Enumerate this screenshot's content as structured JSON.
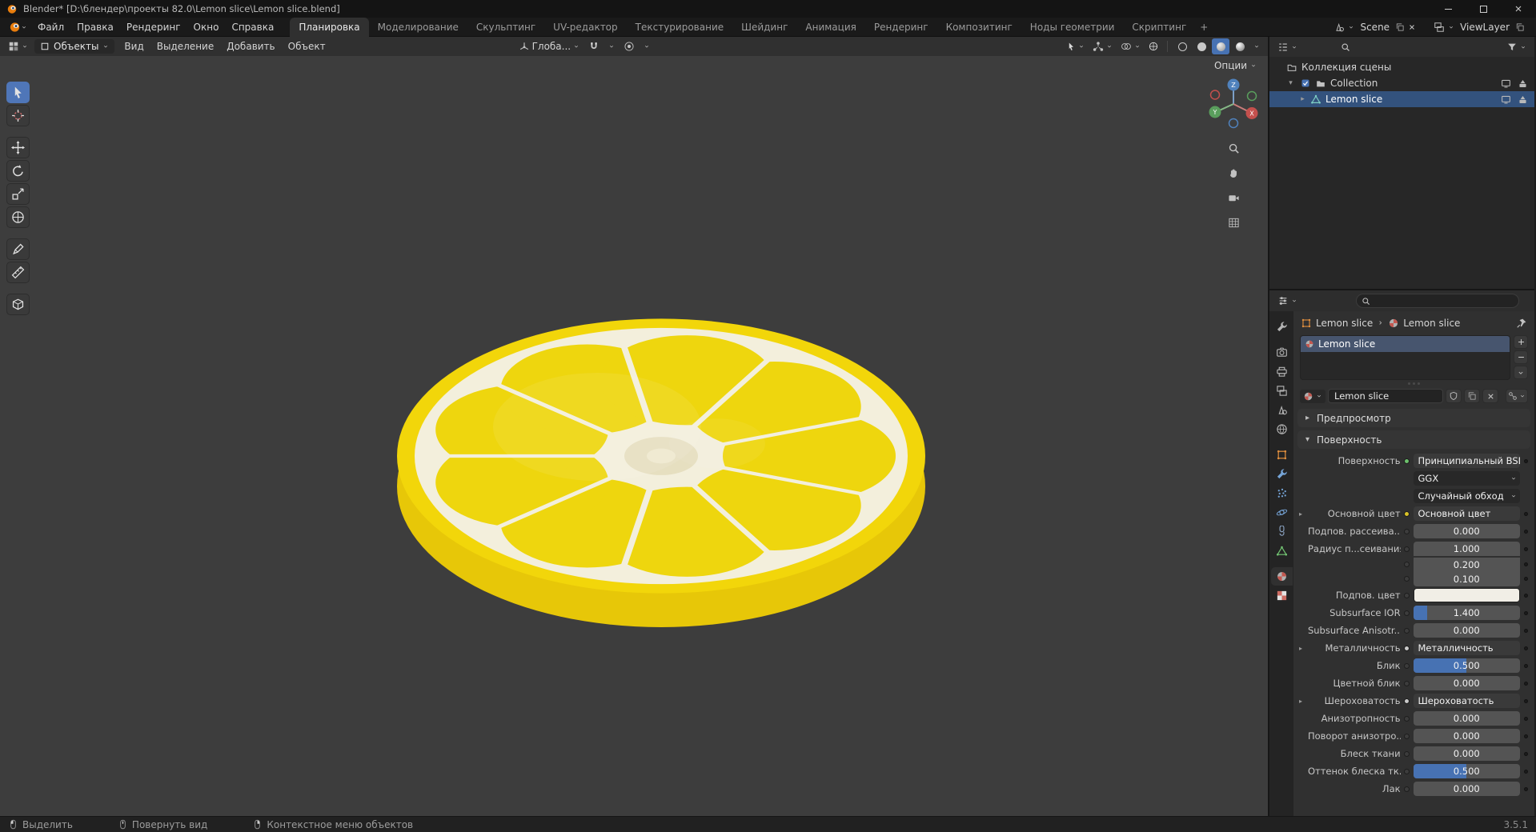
{
  "title_bar": {
    "title": "Blender* [D:\\блендер\\проекты 82.0\\Lemon slice\\Lemon slice.blend]"
  },
  "menus": [
    "Файл",
    "Правка",
    "Рендеринг",
    "Окно",
    "Справка"
  ],
  "workspaces": [
    "Планировка",
    "Моделирование",
    "Скульптинг",
    "UV-редактор",
    "Текстурирование",
    "Шейдинг",
    "Анимация",
    "Рендеринг",
    "Композитинг",
    "Ноды геометрии",
    "Скриптинг"
  ],
  "active_workspace": "Планировка",
  "workspace_add": "+",
  "topbar_right": {
    "scene_label": "Scene",
    "viewlayer_label": "ViewLayer"
  },
  "viewport_header": {
    "mode": "Объекты",
    "menus": [
      "Вид",
      "Выделение",
      "Добавить",
      "Объект"
    ],
    "orientation": "Глоба...",
    "options_label": "Опции"
  },
  "tools": {
    "active": "select-box",
    "groups": [
      [
        "select-box",
        "cursor"
      ],
      [
        "move",
        "rotate",
        "scale",
        "transform"
      ],
      [
        "annotate",
        "measure"
      ],
      [
        "add-cube"
      ]
    ]
  },
  "gizmo_axes": {
    "x": "X",
    "y": "Y",
    "z": "Z"
  },
  "outliner": {
    "rows": [
      {
        "icon": "scene-collection",
        "label": "Коллекция сцены",
        "indent": 0,
        "arrow": "",
        "right": []
      },
      {
        "icon": "collection",
        "label": "Collection",
        "indent": 1,
        "arrow": "▾",
        "checkbox": true,
        "right": [
          "monitor",
          "camera-obj"
        ]
      },
      {
        "icon": "mesh-tri",
        "label": "Lemon slice",
        "indent": 2,
        "arrow": "▸",
        "selected": true,
        "right": [
          "monitor",
          "camera-obj"
        ]
      }
    ]
  },
  "properties": {
    "active_tab": "material",
    "tabs": [
      "tool",
      "gap",
      "render",
      "output",
      "view-layer",
      "scene",
      "world",
      "gap",
      "object",
      "modifiers",
      "particles",
      "physics",
      "constraints",
      "data",
      "gap",
      "material",
      "texture"
    ],
    "breadcrumb": {
      "object": "Lemon slice",
      "material": "Lemon slice"
    },
    "slot_name": "Lemon slice",
    "material_name": "Lemon slice",
    "preview_panel": "Предпросмотр",
    "surface_panel": "Поверхность",
    "arrow_collapsed": "▸",
    "arrow_expanded": "▾",
    "arrow_link": "▸",
    "rows": [
      {
        "kind": "shader",
        "label": "Поверхность",
        "value": "Принципиальный BSDF",
        "socket": "#6cc06c"
      },
      {
        "kind": "dropdown",
        "value": "GGX"
      },
      {
        "kind": "dropdown",
        "value": "Случайный обход"
      },
      {
        "kind": "link",
        "label": "Основной цвет",
        "value": "Основной цвет",
        "socket": "#d8c229"
      },
      {
        "kind": "number",
        "label": "Подпов. рассеива...",
        "value": "0.000"
      },
      {
        "kind": "number",
        "label": "Радиус п...сеивания",
        "value": "1.000",
        "group": "top"
      },
      {
        "kind": "number",
        "label": "",
        "value": "0.200",
        "group": "mid"
      },
      {
        "kind": "number",
        "label": "",
        "value": "0.100",
        "group": "bottom"
      },
      {
        "kind": "color",
        "label": "Подпов. цвет",
        "color": "#f1eee6"
      },
      {
        "kind": "slider",
        "label": "Subsurface IOR",
        "value": "1.400",
        "fill": 0.13
      },
      {
        "kind": "number",
        "label": "Subsurface Anisotr...",
        "value": "0.000"
      },
      {
        "kind": "link",
        "label": "Металличность",
        "value": "Металличность",
        "socket": "#c9c9c9"
      },
      {
        "kind": "slider",
        "label": "Блик",
        "value": "0.500",
        "fill": 0.5
      },
      {
        "kind": "number",
        "label": "Цветной блик",
        "value": "0.000"
      },
      {
        "kind": "link",
        "label": "Шероховатость",
        "value": "Шероховатость",
        "socket": "#c9c9c9"
      },
      {
        "kind": "number",
        "label": "Анизотропность",
        "value": "0.000"
      },
      {
        "kind": "number",
        "label": "Поворот анизотро...",
        "value": "0.000"
      },
      {
        "kind": "number",
        "label": "Блеск ткани",
        "value": "0.000"
      },
      {
        "kind": "slider",
        "label": "Оттенок блеска тк...",
        "value": "0.500",
        "fill": 0.5
      },
      {
        "kind": "number",
        "label": "Лак",
        "value": "0.000"
      }
    ]
  },
  "status_bar": {
    "hints": [
      {
        "mouse": "mouse-left",
        "label": "Выделить"
      },
      {
        "mouse": "mouse-middle",
        "label": "Повернуть вид"
      },
      {
        "mouse": "mouse-right",
        "label": "Контекстное меню объектов"
      }
    ],
    "version": "3.5.1"
  },
  "colors": {
    "accent": "#4772b3",
    "selection": "#33527d",
    "lemon_rind": "#f2d60a",
    "lemon_pith": "#f3efdc",
    "lemon_flesh": "#eed60e"
  }
}
